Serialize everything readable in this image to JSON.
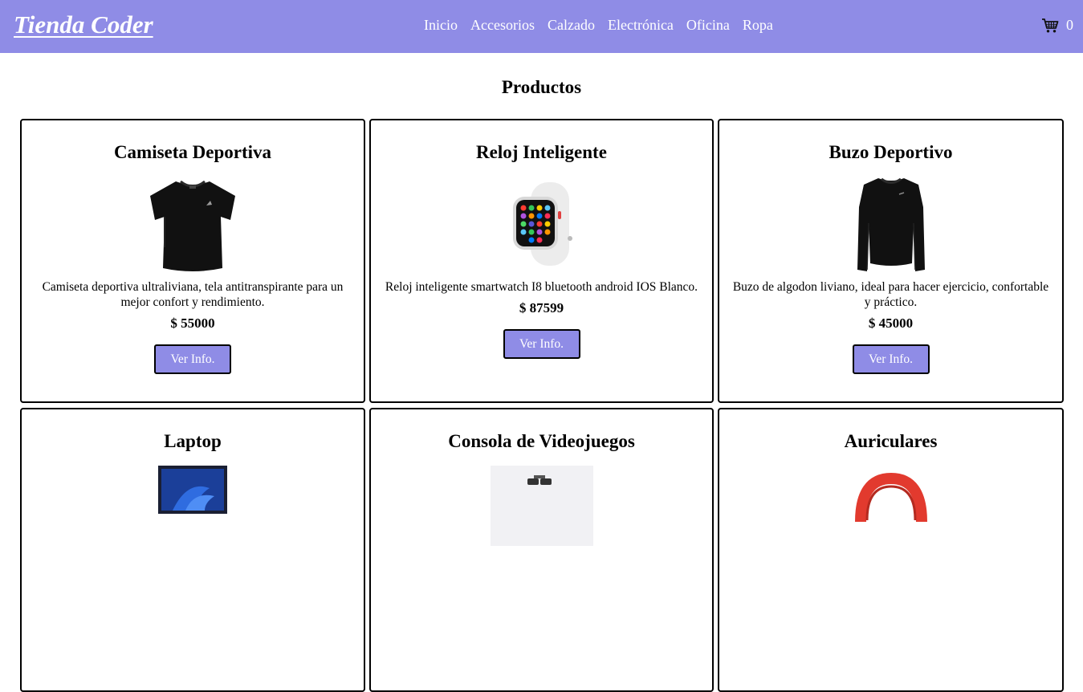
{
  "header": {
    "brand": "Tienda Coder",
    "nav": [
      "Inicio",
      "Accesorios",
      "Calzado",
      "Electrónica",
      "Oficina",
      "Ropa"
    ],
    "cart_count": "0",
    "bg_color": "#8f8ce6"
  },
  "main": {
    "title": "Productos",
    "products": [
      {
        "name": "Camiseta Deportiva",
        "desc": "Camiseta deportiva ultraliviana, tela antitranspirante para un mejor confort y rendimiento.",
        "price": "$ 55000",
        "button": "Ver Info.",
        "image_icon": "tshirt-image"
      },
      {
        "name": "Reloj Inteligente",
        "desc": "Reloj inteligente smartwatch I8 bluetooth android IOS Blanco.",
        "price": "$ 87599",
        "button": "Ver Info.",
        "image_icon": "smartwatch-image"
      },
      {
        "name": "Buzo Deportivo",
        "desc": "Buzo de algodon liviano, ideal para hacer ejercicio, confortable y práctico.",
        "price": "$ 45000",
        "button": "Ver Info.",
        "image_icon": "sweater-image"
      },
      {
        "name": "Laptop",
        "image_icon": "laptop-image"
      },
      {
        "name": "Consola de Videojuegos",
        "image_icon": "console-image"
      },
      {
        "name": "Auriculares",
        "image_icon": "headphones-image"
      }
    ]
  }
}
